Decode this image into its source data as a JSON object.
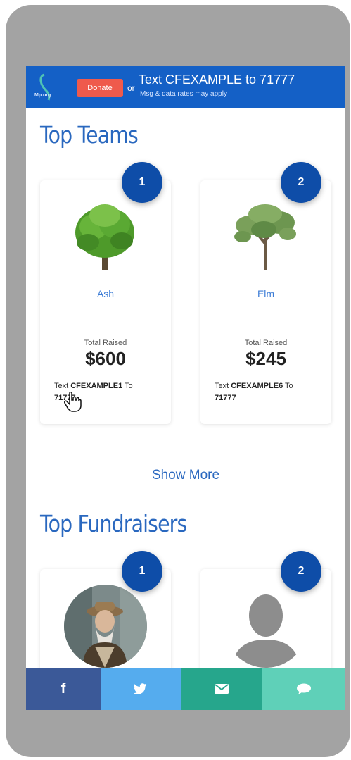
{
  "banner": {
    "logo_text": "Mp.org",
    "donate_label": "Donate",
    "or_label": "or",
    "text_main": "Text CFEXAMPLE to 71777",
    "text_sub": "Msg & data rates may apply"
  },
  "top_teams": {
    "title": "Top Teams",
    "teams": [
      {
        "rank": "1",
        "name": "Ash",
        "raised_label": "Total Raised",
        "amount": "$600",
        "text_prefix": "Text ",
        "code": "CFEXAMPLE1",
        "to_label": " To",
        "number": "71777"
      },
      {
        "rank": "2",
        "name": "Elm",
        "raised_label": "Total Raised",
        "amount": "$245",
        "text_prefix": "Text ",
        "code": "CFEXAMPLE6",
        "to_label": " To",
        "number": "71777"
      }
    ],
    "show_more": "Show More"
  },
  "top_fundraisers": {
    "title": "Top Fundraisers",
    "fundraisers": [
      {
        "rank": "1"
      },
      {
        "rank": "2"
      }
    ]
  },
  "share": {
    "facebook_icon": "f",
    "twitter_icon": "twitter-bird",
    "email_icon": "envelope",
    "sms_icon": "chat-bubble"
  },
  "colors": {
    "banner": "#1460c6",
    "donate": "#ef5a4c",
    "rank_badge": "#0e4da8",
    "facebook": "#3b5998",
    "twitter": "#55acee",
    "email": "#26a68c",
    "sms": "#5fd0b8"
  }
}
